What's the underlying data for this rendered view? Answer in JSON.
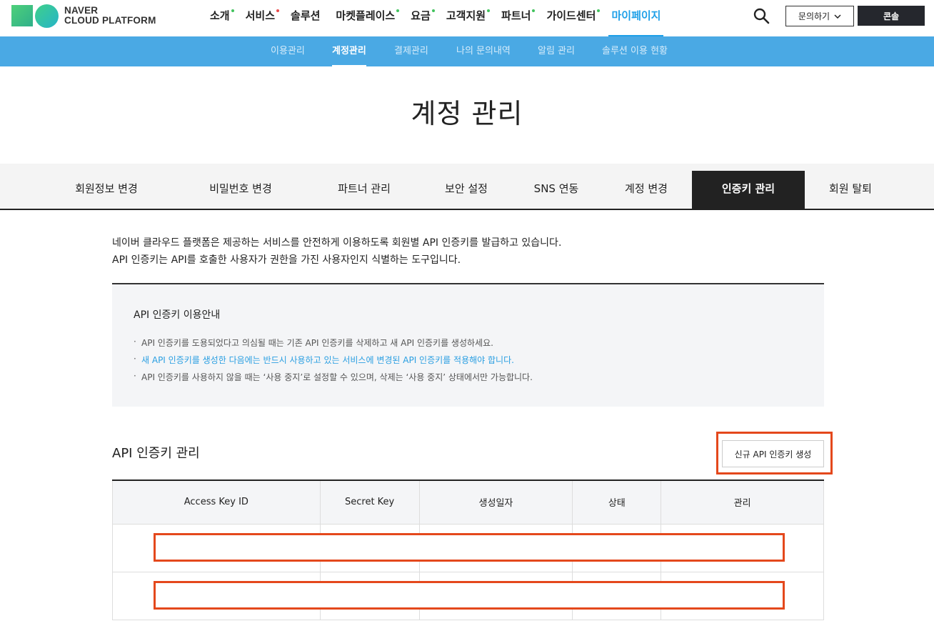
{
  "header": {
    "logo_text_line1": "NAVER",
    "logo_text_line2": "CLOUD PLATFORM",
    "nav": [
      {
        "label": "소개",
        "dot": "#43c35e"
      },
      {
        "label": "서비스",
        "dot": "#e84a4a"
      },
      {
        "label": "솔루션",
        "dot": ""
      },
      {
        "label": "마켓플레이스",
        "dot": "#43c35e"
      },
      {
        "label": "요금",
        "dot": "#43c35e"
      },
      {
        "label": "고객지원",
        "dot": "#43c35e"
      },
      {
        "label": "파트너",
        "dot": "#43c35e"
      },
      {
        "label": "가이드센터",
        "dot": "#43c35e"
      },
      {
        "label": "마이페이지",
        "dot": "",
        "active": true
      }
    ],
    "search_icon": "search-icon",
    "inquiry_label": "문의하기",
    "console_label": "콘솔"
  },
  "subnav": {
    "items": [
      "이용관리",
      "계정관리",
      "결제관리",
      "나의 문의내역",
      "알림 관리",
      "솔루션 이용 현황"
    ],
    "active_index": 1
  },
  "page": {
    "title": "계정 관리"
  },
  "tabs": {
    "items": [
      "회원정보 변경",
      "비밀번호 변경",
      "파트너 관리",
      "보안 설정",
      "SNS 연동",
      "계정 변경",
      "인증키 관리",
      "회원 탈퇴"
    ],
    "active_index": 6
  },
  "intro": {
    "line1": "네이버 클라우드 플랫폼은 제공하는 서비스를 안전하게 이용하도록 회원별 API 인증키를 발급하고 있습니다.",
    "line2": "API 인증키는 API를 호출한 사용자가 권한을 가진 사용자인지 식별하는 도구입니다."
  },
  "guide": {
    "title": "API 인증키 이용안내",
    "items": [
      "API 인증키를 도용되었다고 의심될 때는 기존 API 인증키를 삭제하고 새 API 인증키를 생성하세요.",
      "새 API 인증키를 생성한 다음에는 반드시 사용하고 있는 서비스에 변경된 API 인증키를 적용해야 합니다.",
      "API 인증키를 사용하지 않을 때는 ‘사용 중지’로 설정할 수 있으며, 삭제는 ‘사용 중지’ 상태에서만 가능합니다."
    ]
  },
  "keys": {
    "section_title": "API 인증키 관리",
    "create_label": "신규 API 인증키 생성",
    "columns": [
      "Access Key ID",
      "Secret Key",
      "생성일자",
      "상태",
      "관리"
    ],
    "rows": 2
  },
  "colors": {
    "accent": "#1ea0e8",
    "subnav_bg": "#4aa9e4",
    "highlight_box": "#e4481c",
    "dark": "#222222"
  }
}
